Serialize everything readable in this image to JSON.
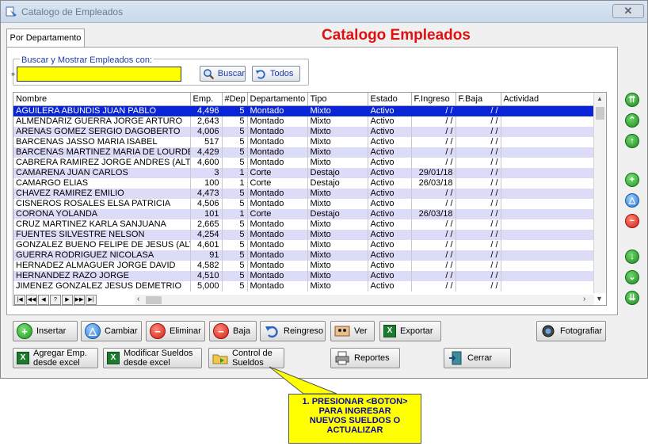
{
  "window": {
    "title": "Catalogo de Empleados",
    "close_label": "✕"
  },
  "tab": {
    "label": "Por Departamento"
  },
  "header": {
    "title": "Catalogo Empleados"
  },
  "search": {
    "legend": "Buscar y Mostrar Empleados con:",
    "value": "",
    "placeholder": "",
    "buscar_label": "Buscar",
    "todos_label": "Todos"
  },
  "grid": {
    "columns": [
      "Nombre",
      "Emp.",
      "#Dep",
      "Departamento",
      "Tipo",
      "Estado",
      "F.Ingreso",
      "F.Baja",
      "Actividad"
    ],
    "rows": [
      [
        "AGUILERA ABUNDIS JUAN PABLO",
        "4,496",
        "5",
        "Montado",
        "Mixto",
        "Activo",
        "/ /",
        "/ /",
        ""
      ],
      [
        "ALMENDARIZ GUERRA JORGE ARTURO",
        "2,643",
        "5",
        "Montado",
        "Mixto",
        "Activo",
        "/ /",
        "/ /",
        ""
      ],
      [
        "ARENAS GOMEZ SERGIO DAGOBERTO",
        "4,006",
        "5",
        "Montado",
        "Mixto",
        "Activo",
        "/ /",
        "/ /",
        ""
      ],
      [
        "BARCENAS JASSO MARIA ISABEL",
        "517",
        "5",
        "Montado",
        "Mixto",
        "Activo",
        "/ /",
        "/ /",
        ""
      ],
      [
        "BARCENAS MARTINEZ MARIA DE LOURDE",
        "4,429",
        "5",
        "Montado",
        "Mixto",
        "Activo",
        "/ /",
        "/ /",
        ""
      ],
      [
        "CABRERA RAMIREZ JORGE ANDRES (ALTA",
        "4,600",
        "5",
        "Montado",
        "Mixto",
        "Activo",
        "/ /",
        "/ /",
        ""
      ],
      [
        "CAMARENA JUAN CARLOS",
        "3",
        "1",
        "Corte",
        "Destajo",
        "Activo",
        "29/01/18",
        "/ /",
        ""
      ],
      [
        "CAMARGO ELIAS",
        "100",
        "1",
        "Corte",
        "Destajo",
        "Activo",
        "26/03/18",
        "/ /",
        ""
      ],
      [
        "CHAVEZ RAMIREZ EMILIO",
        "4,473",
        "5",
        "Montado",
        "Mixto",
        "Activo",
        "/ /",
        "/ /",
        ""
      ],
      [
        "CISNEROS ROSALES ELSA PATRICIA",
        "4,506",
        "5",
        "Montado",
        "Mixto",
        "Activo",
        "/ /",
        "/ /",
        ""
      ],
      [
        "CORONA YOLANDA",
        "101",
        "1",
        "Corte",
        "Destajo",
        "Activo",
        "26/03/18",
        "/ /",
        ""
      ],
      [
        "CRUZ MARTINEZ KARLA SANJUANA",
        "2,665",
        "5",
        "Montado",
        "Mixto",
        "Activo",
        "/ /",
        "/ /",
        ""
      ],
      [
        "FUENTES SILVESTRE NELSON",
        "4,254",
        "5",
        "Montado",
        "Mixto",
        "Activo",
        "/ /",
        "/ /",
        ""
      ],
      [
        "GONZALEZ BUENO FELIPE DE JESUS (ALT",
        "4,601",
        "5",
        "Montado",
        "Mixto",
        "Activo",
        "/ /",
        "/ /",
        ""
      ],
      [
        "GUERRA RODRIGUEZ NICOLASA",
        "91",
        "5",
        "Montado",
        "Mixto",
        "Activo",
        "/ /",
        "/ /",
        ""
      ],
      [
        "HERNADEZ ALMAGUER JORGE DAVID",
        "4,582",
        "5",
        "Montado",
        "Mixto",
        "Activo",
        "/ /",
        "/ /",
        ""
      ],
      [
        "HERNANDEZ RAZO JORGE",
        "4,510",
        "5",
        "Montado",
        "Mixto",
        "Activo",
        "/ /",
        "/ /",
        ""
      ],
      [
        "JIMENEZ GONZALEZ JESUS DEMETRIO",
        "5,000",
        "5",
        "Montado",
        "Mixto",
        "Activo",
        "/ /",
        "/ /",
        ""
      ]
    ],
    "nav_buttons": [
      "|◀",
      "◀◀",
      "◀",
      "?",
      "▶",
      "▶▶",
      "▶|"
    ]
  },
  "buttons": {
    "insertar": "Insertar",
    "cambiar": "Cambiar",
    "eliminar": "Eliminar",
    "baja": "Baja",
    "reingreso": "Reingreso",
    "ver": "Ver",
    "exportar": "Exportar",
    "fotografiar": "Fotografiar",
    "agregar_line1": "Agregar Emp.",
    "agregar_line2": "desde excel",
    "modificar_line1": "Modificar Sueldos",
    "modificar_line2": "desde excel",
    "control_line1": "Control de",
    "control_line2": "Sueldos",
    "reportes": "Reportes",
    "cerrar": "Cerrar"
  },
  "callout": {
    "line1": "1. PRESIONAR <BOTON>",
    "line2": "PARA INGRESAR",
    "line3": "NUEVOS SUELDOS O",
    "line4": "ACTUALIZAR"
  },
  "colors": {
    "title_red": "#e01010",
    "selected_row": "#0a24d8",
    "alt_row": "#dcdcf8",
    "search_bg": "#ffff00",
    "callout_bg": "#ffff00"
  }
}
